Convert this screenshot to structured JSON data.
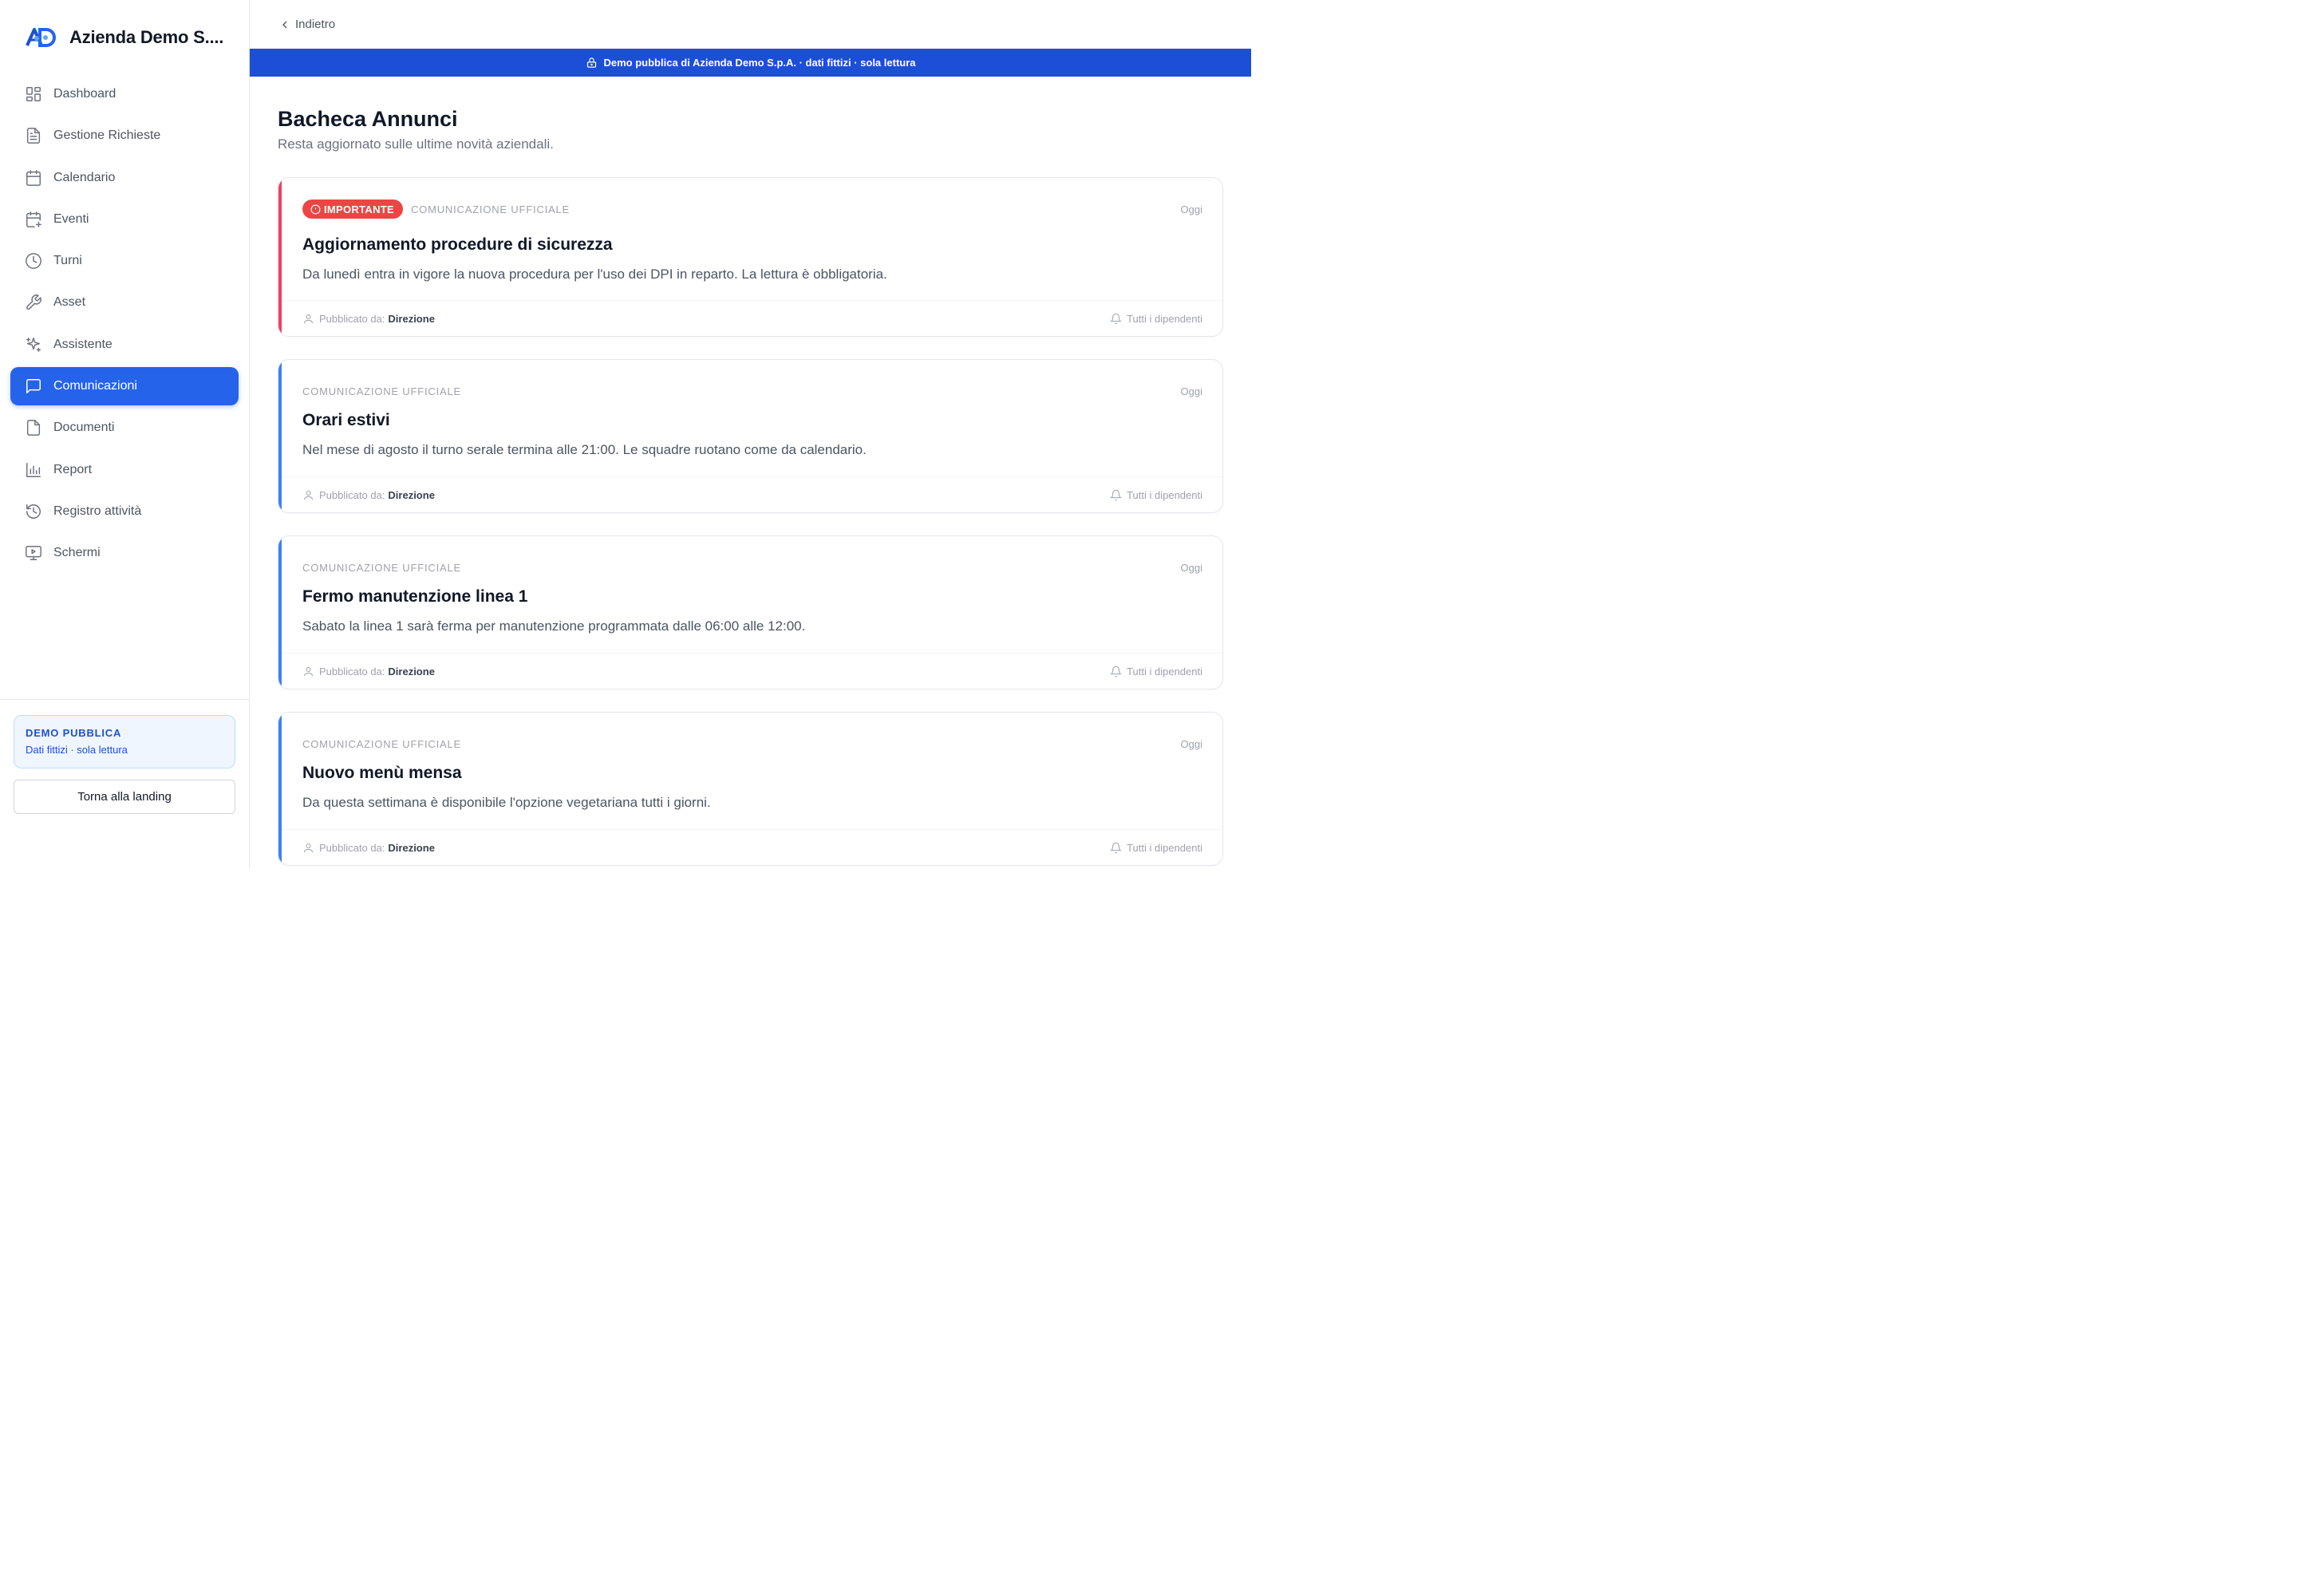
{
  "brand": {
    "name": "Azienda Demo S...."
  },
  "sidebar": {
    "items": [
      {
        "label": "Dashboard",
        "icon": "dashboard-icon"
      },
      {
        "label": "Gestione Richieste",
        "icon": "document-icon"
      },
      {
        "label": "Calendario",
        "icon": "calendar-icon"
      },
      {
        "label": "Eventi",
        "icon": "calendar-plus-icon"
      },
      {
        "label": "Turni",
        "icon": "clock-icon"
      },
      {
        "label": "Asset",
        "icon": "wrench-icon"
      },
      {
        "label": "Assistente",
        "icon": "sparkles-icon"
      },
      {
        "label": "Comunicazioni",
        "icon": "message-icon",
        "active": true
      },
      {
        "label": "Documenti",
        "icon": "file-icon"
      },
      {
        "label": "Report",
        "icon": "bar-chart-icon"
      },
      {
        "label": "Registro attività",
        "icon": "history-icon"
      },
      {
        "label": "Schermi",
        "icon": "monitor-icon"
      }
    ],
    "demo_box": {
      "title": "DEMO PUBBLICA",
      "subtitle": "Dati fittizi · sola lettura"
    },
    "back_button": "Torna alla landing"
  },
  "topbar": {
    "back_label": "Indietro"
  },
  "banner": {
    "text": "Demo pubblica di Azienda Demo S.p.A. · dati fittizi · sola lettura"
  },
  "page": {
    "title": "Bacheca Annunci",
    "subtitle": "Resta aggiornato sulle ultime novità aziendali."
  },
  "colors": {
    "primary": "#2563eb",
    "banner": "#1d4ed8",
    "important": "#ef4444",
    "accent_red": "#f43f5e",
    "accent_blue": "#3b82f6"
  },
  "announcements": [
    {
      "badge": "IMPORTANTE",
      "category": "COMUNICAZIONE UFFICIALE",
      "date": "Oggi",
      "title": "Aggiornamento procedure di sicurezza",
      "text": "Da lunedì entra in vigore la nuova procedura per l'uso dei DPI in reparto. La lettura è obbligatoria.",
      "published_label": "Pubblicato da:",
      "author": "Direzione",
      "audience": "Tutti i dipendenti"
    },
    {
      "category": "COMUNICAZIONE UFFICIALE",
      "date": "Oggi",
      "title": "Orari estivi",
      "text": "Nel mese di agosto il turno serale termina alle 21:00. Le squadre ruotano come da calendario.",
      "published_label": "Pubblicato da:",
      "author": "Direzione",
      "audience": "Tutti i dipendenti"
    },
    {
      "category": "COMUNICAZIONE UFFICIALE",
      "date": "Oggi",
      "title": "Fermo manutenzione linea 1",
      "text": "Sabato la linea 1 sarà ferma per manutenzione programmata dalle 06:00 alle 12:00.",
      "published_label": "Pubblicato da:",
      "author": "Direzione",
      "audience": "Tutti i dipendenti"
    },
    {
      "category": "COMUNICAZIONE UFFICIALE",
      "date": "Oggi",
      "title": "Nuovo menù mensa",
      "text": "Da questa settimana è disponibile l'opzione vegetariana tutti i giorni.",
      "published_label": "Pubblicato da:",
      "author": "Direzione",
      "audience": "Tutti i dipendenti"
    }
  ]
}
